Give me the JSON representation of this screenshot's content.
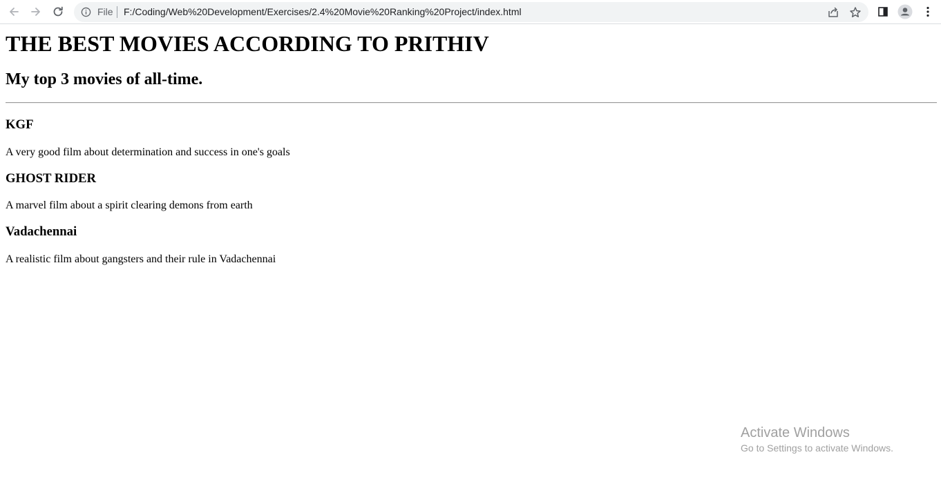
{
  "browser": {
    "scheme_label": "File",
    "url": "F:/Coding/Web%20Development/Exercises/2.4%20Movie%20Ranking%20Project/index.html",
    "icons": {
      "back": "arrow-left-icon",
      "forward": "arrow-right-icon",
      "reload": "reload-icon",
      "info": "info-icon",
      "share": "share-icon",
      "bookmark": "star-icon",
      "side_panel": "side-panel-icon",
      "profile": "profile-icon",
      "menu": "kebab-menu-icon"
    }
  },
  "page": {
    "heading": "THE BEST MOVIES ACCORDING TO PRITHIV",
    "subheading": "My top 3 movies of all-time.",
    "movies": [
      {
        "title": "KGF",
        "description": "A very good film about determination and success in one's goals"
      },
      {
        "title": "GHOST RIDER",
        "description": "A marvel film about a spirit clearing demons from earth"
      },
      {
        "title": "Vadachennai",
        "description": "A realistic film about gangsters and their rule in Vadachennai"
      }
    ]
  },
  "watermark": {
    "title": "Activate Windows",
    "subtitle": "Go to Settings to activate Windows."
  }
}
